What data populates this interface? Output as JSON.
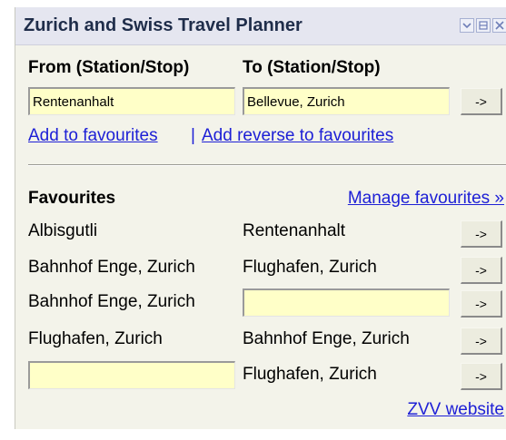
{
  "title": "Zurich and Swiss Travel Planner",
  "window_buttons": [
    "collapse-icon",
    "minimize-icon",
    "close-icon"
  ],
  "journey": {
    "from_label": "From (Station/Stop)",
    "to_label": "To (Station/Stop)",
    "from_value": "Rentenanhalt",
    "to_value": "Bellevue, Zurich",
    "go_label": "->"
  },
  "links": {
    "add_favourites": "Add to favourites",
    "separator": "|",
    "add_reverse": "Add reverse to favourites"
  },
  "favourites": {
    "heading": "Favourites",
    "manage": "Manage favourites »",
    "rows": [
      {
        "from": "Albisgutli",
        "to": "Rentenanhalt",
        "go": "->"
      },
      {
        "from": "Bahnhof Enge, Zurich",
        "to": "Flughafen, Zurich",
        "go": "->"
      },
      {
        "from": "Bahnhof Enge, Zurich",
        "to": "",
        "go": "->"
      },
      {
        "from": "Flughafen, Zurich",
        "to": "Bahnhof Enge, Zurich",
        "go": "->"
      },
      {
        "from": "",
        "to": "Flughafen, Zurich",
        "go": "->"
      }
    ]
  },
  "footer_link": "ZVV website",
  "colors": {
    "input_bg": "#ffffc8",
    "link": "#1e20d6",
    "titlebar_bg": "#e5e6f0",
    "title_text": "#1f2d4a",
    "panel_bg": "#f3f3ea"
  }
}
